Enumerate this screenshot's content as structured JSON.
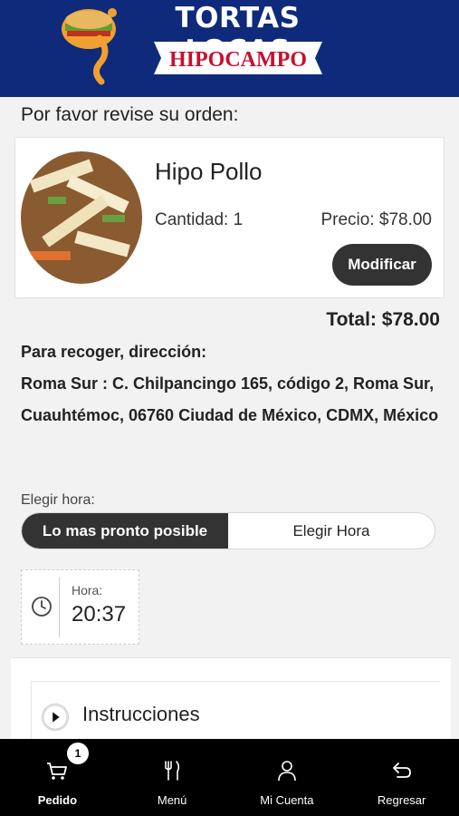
{
  "header": {
    "brand_title": "TORTAS LOCAS",
    "brand_banner": "HIPOCAMPO",
    "colors": {
      "background": "#0f2a7a",
      "banner_text": "#c8102e"
    }
  },
  "review_title": "Por favor revise su orden:",
  "order": {
    "item_name": "Hipo Pollo",
    "quantity_text": "Cantidad: 1",
    "price_text": "Precio: $78.00",
    "modify_label": "Modificar"
  },
  "total_text": "Total: $78.00",
  "pickup": {
    "label": "Para recoger, dirección:",
    "address": "Roma Sur : C. Chilpancingo 165, código 2, Roma Sur, Cuauhtémoc, 06760 Ciudad de México, CDMX, México"
  },
  "time_selection": {
    "label": "Elegir hora:",
    "option_asap": "Lo mas pronto posible",
    "option_choose": "Elegir Hora",
    "selected": "Lo mas pronto posible"
  },
  "hour": {
    "label": "Hora:",
    "value": "20:37",
    "icon": "clock-icon"
  },
  "instructions": {
    "label": "Instrucciones",
    "icon": "play-icon"
  },
  "bottom_nav": {
    "items": [
      {
        "label": "Pedido",
        "icon": "cart-icon",
        "badge": "1",
        "active": true
      },
      {
        "label": "Menú",
        "icon": "fork-knife-icon"
      },
      {
        "label": "Mi Cuenta",
        "icon": "user-icon"
      },
      {
        "label": "Regresar",
        "icon": "back-arrow-icon"
      }
    ]
  }
}
